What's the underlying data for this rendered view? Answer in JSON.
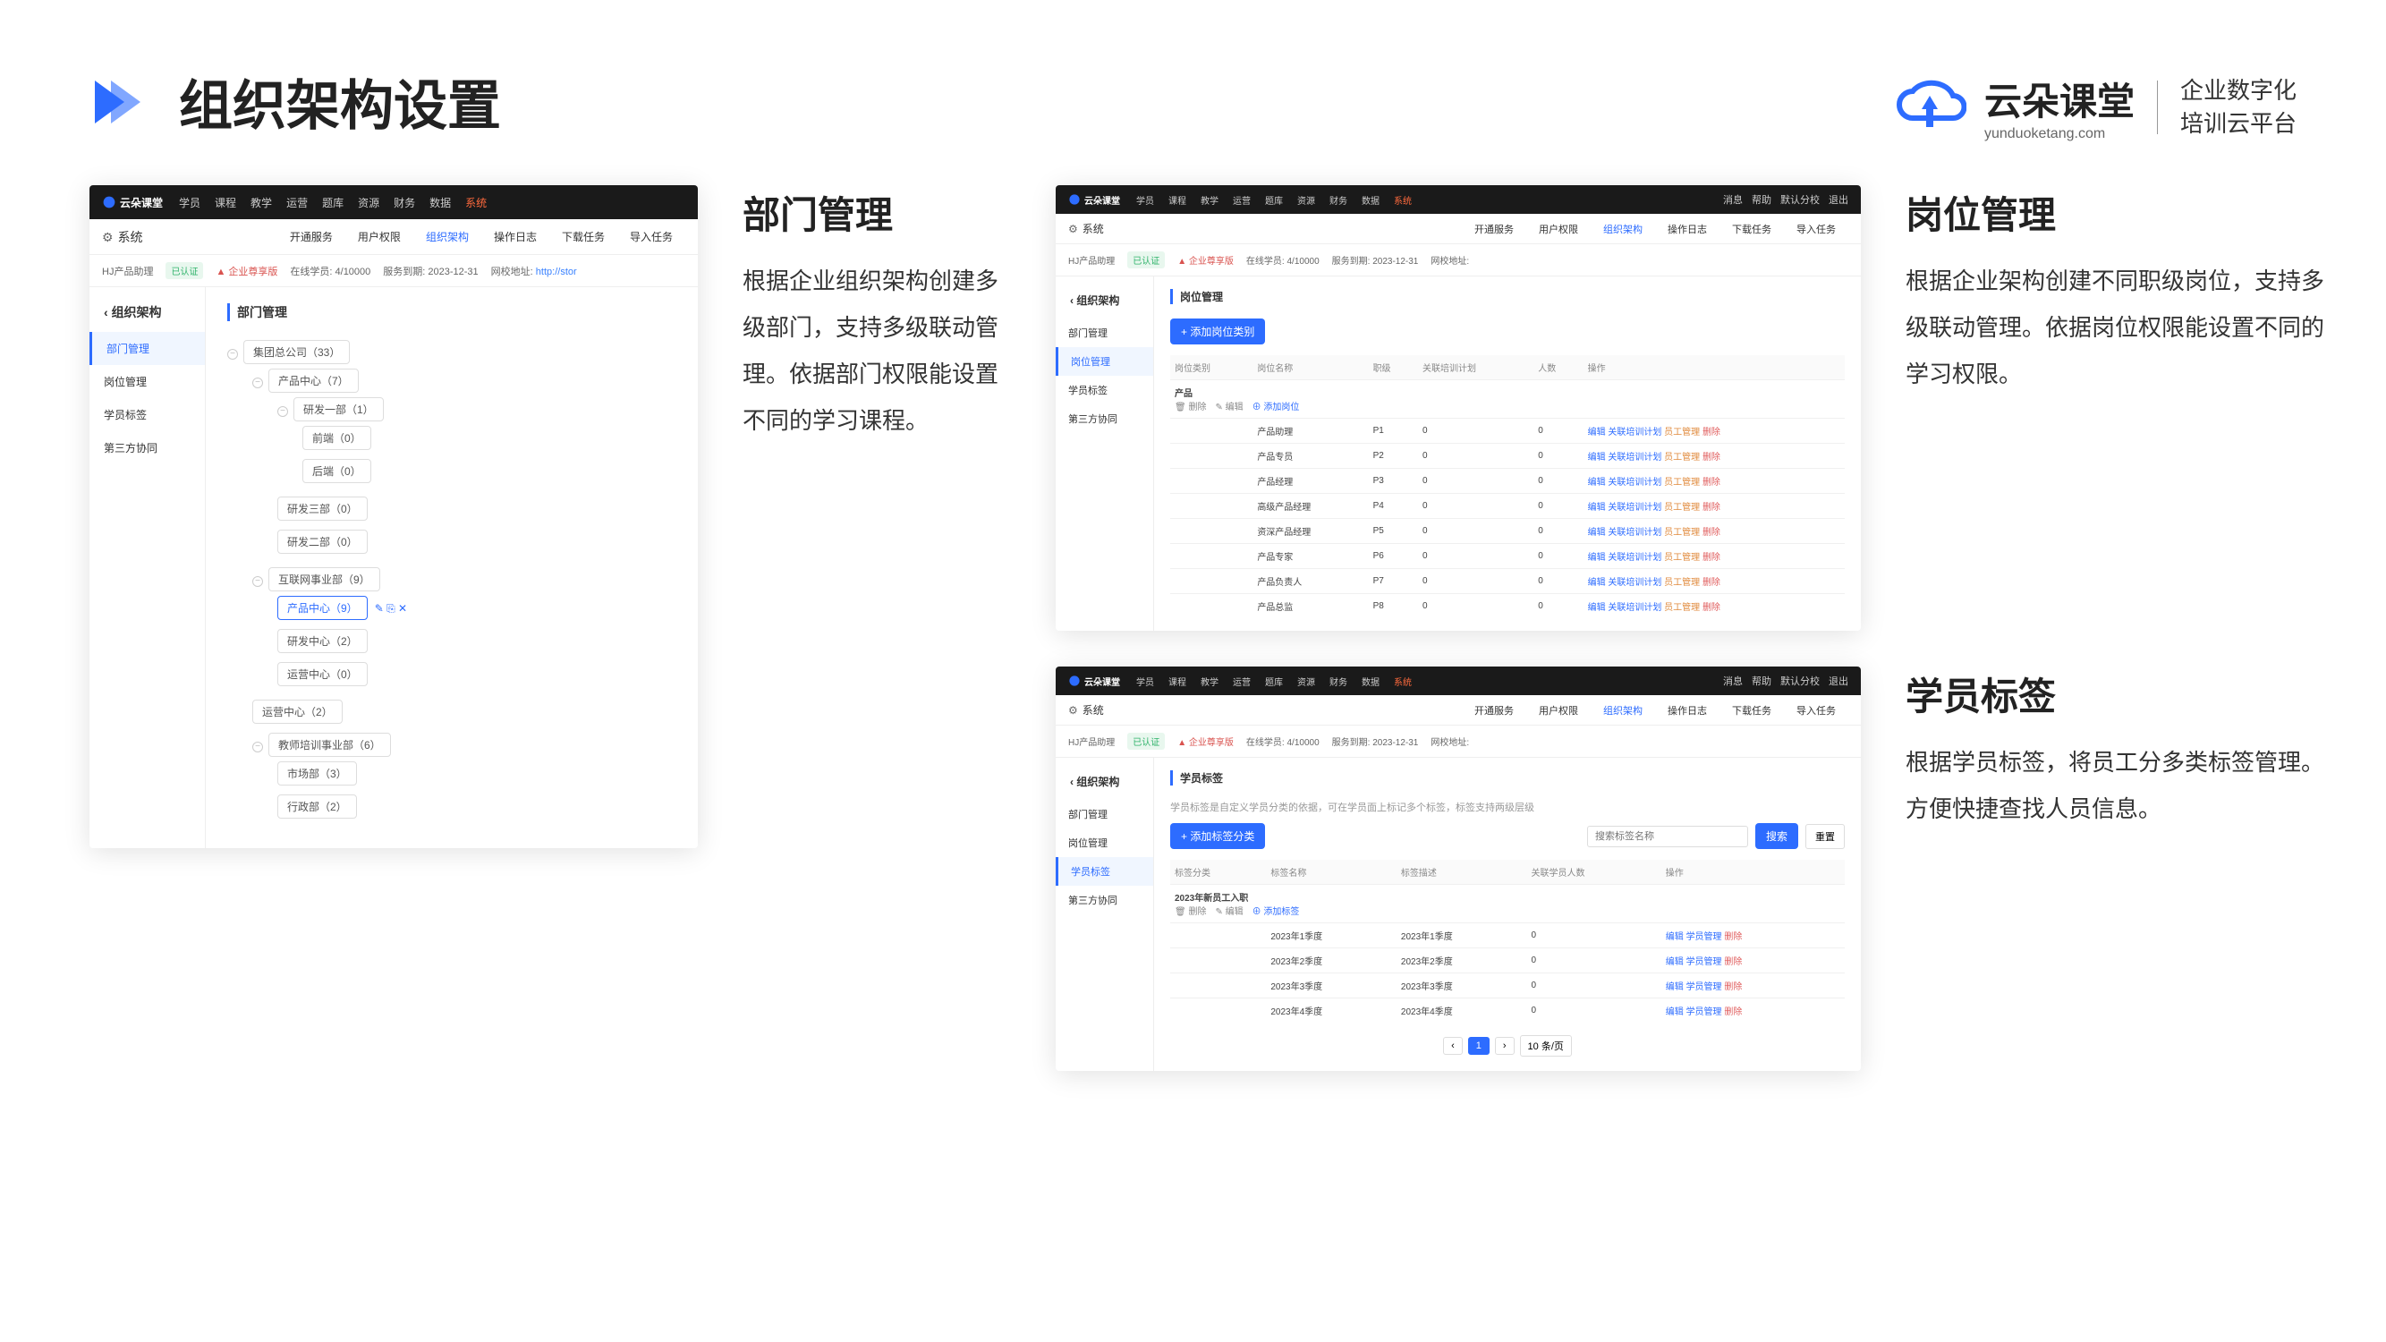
{
  "header": {
    "title": "组织架构设置",
    "brand_main": "云朵课堂",
    "brand_sub": "yunduoketang.com",
    "brand_slogan_l1": "企业数字化",
    "brand_slogan_l2": "培训云平台"
  },
  "desc1": {
    "title": "部门管理",
    "body": "根据企业组织架构创建多级部门，支持多级联动管理。依据部门权限能设置不同的学习课程。"
  },
  "desc2": {
    "title": "岗位管理",
    "body": "根据企业架构创建不同职级岗位，支持多级联动管理。依据岗位权限能设置不同的学习权限。"
  },
  "desc3": {
    "title": "学员标签",
    "body": "根据学员标签，将员工分多类标签管理。方便快捷查找人员信息。"
  },
  "topnav": {
    "logo": "云朵课堂",
    "items": [
      "学员",
      "课程",
      "教学",
      "运营",
      "题库",
      "资源",
      "财务",
      "数据",
      "系统"
    ],
    "right": [
      "消息",
      "帮助",
      "默认分校",
      "退出"
    ]
  },
  "submenu": {
    "sys": "系统",
    "items": [
      "开通服务",
      "用户权限",
      "组织架构",
      "操作日志",
      "下载任务",
      "导入任务"
    ]
  },
  "infobar": {
    "product": "HJ产品助理",
    "cert_badge": "已认证",
    "plan": "企业尊享版",
    "online": "在线学员: 4/10000",
    "expire": "服务到期: 2023-12-31",
    "site": "网校地址:",
    "site_url": "http://stor"
  },
  "leftnav": {
    "head": "组织架构",
    "items": [
      "部门管理",
      "岗位管理",
      "学员标签",
      "第三方协同"
    ]
  },
  "shot_dept": {
    "title": "部门管理",
    "tree": {
      "root": "集团总公司（33）",
      "children": [
        {
          "name": "产品中心（7）",
          "children": [
            {
              "name": "研发一部（1）",
              "children": [
                {
                  "name": "前端（0）"
                },
                {
                  "name": "后端（0）"
                }
              ]
            },
            {
              "name": "研发三部（0）"
            },
            {
              "name": "研发二部（0）"
            }
          ]
        },
        {
          "name": "互联网事业部（9）",
          "children": [
            {
              "name": "产品中心（9）",
              "selected": true,
              "icons": true
            },
            {
              "name": "研发中心（2）"
            },
            {
              "name": "运营中心（0）"
            }
          ]
        },
        {
          "name": "运营中心（2）"
        },
        {
          "name": "教师培训事业部（6）",
          "children": [
            {
              "name": "市场部（3）"
            },
            {
              "name": "行政部（2）"
            }
          ]
        }
      ]
    }
  },
  "shot_post": {
    "title": "岗位管理",
    "btn": "+ 添加岗位类别",
    "columns": [
      "岗位类别",
      "岗位名称",
      "职级",
      "关联培训计划",
      "人数",
      "操作"
    ],
    "group": {
      "name": "产品",
      "ops": [
        "删除",
        "编辑",
        "添加岗位"
      ]
    },
    "rows": [
      {
        "name": "产品助理",
        "level": "P1",
        "plan": "0",
        "count": "0"
      },
      {
        "name": "产品专员",
        "level": "P2",
        "plan": "0",
        "count": "0"
      },
      {
        "name": "产品经理",
        "level": "P3",
        "plan": "0",
        "count": "0"
      },
      {
        "name": "高级产品经理",
        "level": "P4",
        "plan": "0",
        "count": "0"
      },
      {
        "name": "资深产品经理",
        "level": "P5",
        "plan": "0",
        "count": "0"
      },
      {
        "name": "产品专家",
        "level": "P6",
        "plan": "0",
        "count": "0"
      },
      {
        "name": "产品负责人",
        "level": "P7",
        "plan": "0",
        "count": "0"
      },
      {
        "name": "产品总监",
        "level": "P8",
        "plan": "0",
        "count": "0"
      }
    ],
    "row_ops": [
      "编辑",
      "关联培训计划",
      "员工管理",
      "删除"
    ]
  },
  "shot_tag": {
    "title": "学员标签",
    "hint": "学员标签是自定义学员分类的依据，可在学员面上标记多个标签，标签支持两级层级",
    "btn": "+ 添加标签分类",
    "search_placeholder": "搜索标签名称",
    "search_btn": "搜索",
    "reset_btn": "重置",
    "columns": [
      "标签分类",
      "标签名称",
      "标签描述",
      "关联学员人数",
      "操作"
    ],
    "group": {
      "name": "2023年新员工入职",
      "ops": [
        "删除",
        "编辑",
        "添加标签"
      ]
    },
    "rows": [
      {
        "name": "2023年1季度",
        "desc": "2023年1季度",
        "count": "0"
      },
      {
        "name": "2023年2季度",
        "desc": "2023年2季度",
        "count": "0"
      },
      {
        "name": "2023年3季度",
        "desc": "2023年3季度",
        "count": "0"
      },
      {
        "name": "2023年4季度",
        "desc": "2023年4季度",
        "count": "0"
      }
    ],
    "row_ops": [
      "编辑",
      "学员管理",
      "删除"
    ],
    "pager": {
      "cur": "1",
      "per": "10 条/页"
    }
  }
}
